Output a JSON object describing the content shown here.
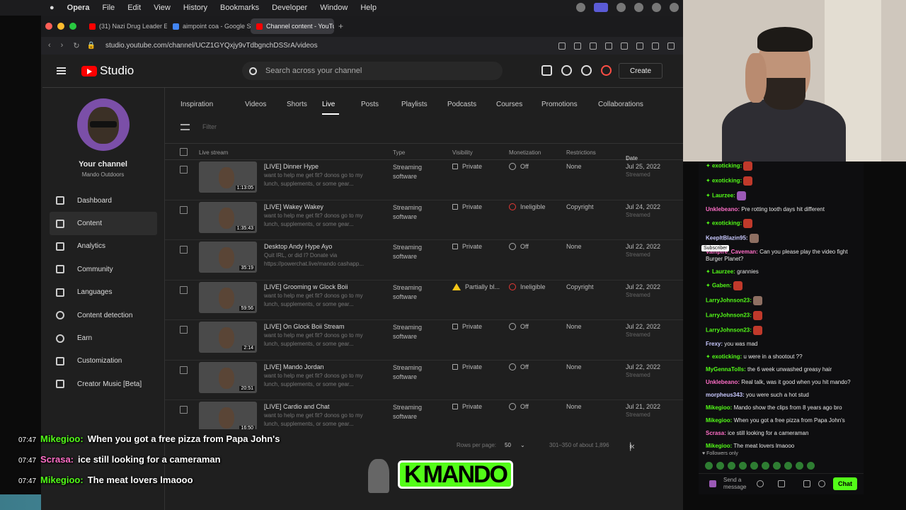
{
  "menubar": {
    "app": "Opera",
    "items": [
      "File",
      "Edit",
      "View",
      "History",
      "Bookmarks",
      "Developer",
      "Window",
      "Help"
    ]
  },
  "tabs": [
    {
      "label": "(31) Nazi Drug Leader E",
      "color": "#ff0000"
    },
    {
      "label": "aimpoint coa - Google S",
      "color": "#4285f4"
    },
    {
      "label": "Channel content - YouTu",
      "color": "#ff0000"
    }
  ],
  "address": {
    "url": "studio.youtube.com/channel/UCZ1GYQxjy9vTdbgnchDSSrA/videos"
  },
  "header": {
    "logo": "Studio",
    "search_placeholder": "Search across your channel",
    "create_label": "Create"
  },
  "sidebar": {
    "channel_name": "Your channel",
    "channel_sub": "Mando Outdoors",
    "items": [
      {
        "label": "Dashboard",
        "icon": "dashboard-icon"
      },
      {
        "label": "Content",
        "icon": "content-icon"
      },
      {
        "label": "Analytics",
        "icon": "analytics-icon"
      },
      {
        "label": "Community",
        "icon": "community-icon"
      },
      {
        "label": "Languages",
        "icon": "languages-icon"
      },
      {
        "label": "Content detection",
        "icon": "copyright-icon"
      },
      {
        "label": "Earn",
        "icon": "dollar-icon"
      },
      {
        "label": "Customization",
        "icon": "wand-icon"
      },
      {
        "label": "Creator Music [Beta]",
        "icon": "music-icon"
      }
    ]
  },
  "content_tabs": [
    "Inspiration",
    "Videos",
    "Shorts",
    "Live",
    "Posts",
    "Playlists",
    "Podcasts",
    "Courses",
    "Promotions",
    "Collaborations"
  ],
  "filter_placeholder": "Filter",
  "table": {
    "headers": {
      "stream": "Live stream",
      "type": "Type",
      "visibility": "Visibility",
      "monetization": "Monetization",
      "restrictions": "Restrictions",
      "date": "Date"
    },
    "rows": [
      {
        "title": "[LIVE] Dinner Hype",
        "desc": "want to help me get fit? donos go to my lunch, supplements, or some gear...",
        "duration": "1:13:05",
        "type1": "Streaming",
        "type2": "software",
        "visibility": "Private",
        "monetization": "Off",
        "restrictions": "None",
        "date": "Jul 25, 2022",
        "date_sub": "Streamed"
      },
      {
        "title": "[LIVE] Wakey Wakey",
        "desc": "want to help me get fit? donos go to my lunch, supplements, or some gear...",
        "duration": "1:35:43",
        "type1": "Streaming",
        "type2": "software",
        "visibility": "Private",
        "monetization": "Ineligible",
        "restrictions": "Copyright",
        "date": "Jul 24, 2022",
        "date_sub": "Streamed"
      },
      {
        "title": "Desktop Andy Hype Ayo",
        "desc": "Quit IRL, or did I? Donate via https://powerchat.live/mando cashapp...",
        "duration": "35:19",
        "type1": "Streaming",
        "type2": "software",
        "visibility": "Private",
        "monetization": "Off",
        "restrictions": "None",
        "date": "Jul 22, 2022",
        "date_sub": "Streamed"
      },
      {
        "title": "[LIVE] Grooming w Glock Boii",
        "desc": "want to help me get fit? donos go to my lunch, supplements, or some gear...",
        "duration": "59:56",
        "type1": "Streaming",
        "type2": "software",
        "visibility": "Partially bl...",
        "monetization": "Ineligible",
        "restrictions": "Copyright",
        "date": "Jul 22, 2022",
        "date_sub": "Streamed"
      },
      {
        "title": "[LIVE] On Glock Boii Stream",
        "desc": "want to help me get fit? donos go to my lunch, supplements, or some gear...",
        "duration": "2:14",
        "type1": "Streaming",
        "type2": "software",
        "visibility": "Private",
        "monetization": "Off",
        "restrictions": "None",
        "date": "Jul 22, 2022",
        "date_sub": "Streamed"
      },
      {
        "title": "[LIVE] Mando Jordan",
        "desc": "want to help me get fit? donos go to my lunch, supplements, or some gear...",
        "duration": "20:51",
        "type1": "Streaming",
        "type2": "software",
        "visibility": "Private",
        "monetization": "Off",
        "restrictions": "None",
        "date": "Jul 22, 2022",
        "date_sub": "Streamed"
      },
      {
        "title": "[LIVE] Cardio and Chat",
        "desc": "want to help me get fit? donos go to my lunch, supplements, or some gear...",
        "duration": "16:50",
        "type1": "Streaming",
        "type2": "software",
        "visibility": "Private",
        "monetization": "Off",
        "restrictions": "None",
        "date": "Jul 21, 2022",
        "date_sub": "Streamed"
      }
    ]
  },
  "pager": {
    "rows_label": "Rows per page:",
    "rows_value": "50",
    "range": "301–350 of about 1,896"
  },
  "chat": {
    "lines": [
      {
        "user": "exoticking:",
        "text": "",
        "color": "#53fc18",
        "emote": "r"
      },
      {
        "user": "exoticking:",
        "text": "",
        "color": "#53fc18",
        "emote": "r"
      },
      {
        "user": "Laurzee:",
        "text": "",
        "color": "#53fc18",
        "emote": "p"
      },
      {
        "user": "Unklebeano:",
        "text": "Pre rotting tooth days hit different",
        "color": "#ff6ec7",
        "emote": ""
      },
      {
        "user": "exoticking:",
        "text": "",
        "color": "#53fc18",
        "emote": "r"
      },
      {
        "user": "KeepItBlazin95:",
        "text": "",
        "color": "#c9c9ff",
        "emote": "g"
      },
      {
        "user": "Vampire_Caveman:",
        "text": "Can you please play the video fight Burger Planet?",
        "color": "#ff6ec7",
        "emote": ""
      },
      {
        "user": "Laurzee:",
        "text": "grannies",
        "color": "#53fc18",
        "emote": ""
      },
      {
        "user": "Gaben:",
        "text": "",
        "color": "#53fc18",
        "emote": "r"
      },
      {
        "user": "LarryJohnson23:",
        "text": "",
        "color": "#53fc18",
        "emote": "g"
      },
      {
        "user": "LarryJohnson23:",
        "text": "",
        "color": "#53fc18",
        "emote": "r"
      },
      {
        "user": "LarryJohnson23:",
        "text": "",
        "color": "#53fc18",
        "emote": "r"
      },
      {
        "user": "Frexy:",
        "text": "you was mad",
        "color": "#c9c9ff",
        "emote": ""
      },
      {
        "user": "exoticking:",
        "text": "u were in a shootout ??",
        "color": "#53fc18",
        "emote": ""
      },
      {
        "user": "MyGennaTolls:",
        "text": "the 6 week unwashed greasy hair",
        "color": "#53fc18",
        "emote": ""
      },
      {
        "user": "Unklebeano:",
        "text": "Real talk, was it good when you hit mando?",
        "color": "#ff6ec7",
        "emote": ""
      },
      {
        "user": "morpheus343:",
        "text": "you were such a hot stud",
        "color": "#c9c9ff",
        "emote": ""
      },
      {
        "user": "Mikegioo:",
        "text": "Mando show the clips from 8 years ago bro",
        "color": "#53fc18",
        "emote": ""
      },
      {
        "user": "Mikegioo:",
        "text": "When you got a free pizza from Papa John's",
        "color": "#53fc18",
        "emote": ""
      },
      {
        "user": "Scrasa:",
        "text": "ice still looking for a cameraman",
        "color": "#ff6ec7",
        "emote": ""
      },
      {
        "user": "Mikegioo:",
        "text": "The meat lovers lmaooo",
        "color": "#53fc18",
        "emote": ""
      }
    ],
    "subscriber_tooltip": "Subscriber",
    "followers_only": "Followers only",
    "send_placeholder": "Send a message",
    "chat_button": "Chat"
  },
  "overlay": {
    "lines": [
      {
        "time": "07:47",
        "user": "Mikegioo:",
        "text": "When you got a free pizza from Papa John's"
      },
      {
        "time": "07:47",
        "user": "Scrasa:",
        "text": "ice still looking for a cameraman"
      },
      {
        "time": "07:47",
        "user": "Mikegioo:",
        "text": "The meat lovers lmaooo"
      }
    ],
    "brand": "MANDO",
    "brand_k": "K"
  }
}
